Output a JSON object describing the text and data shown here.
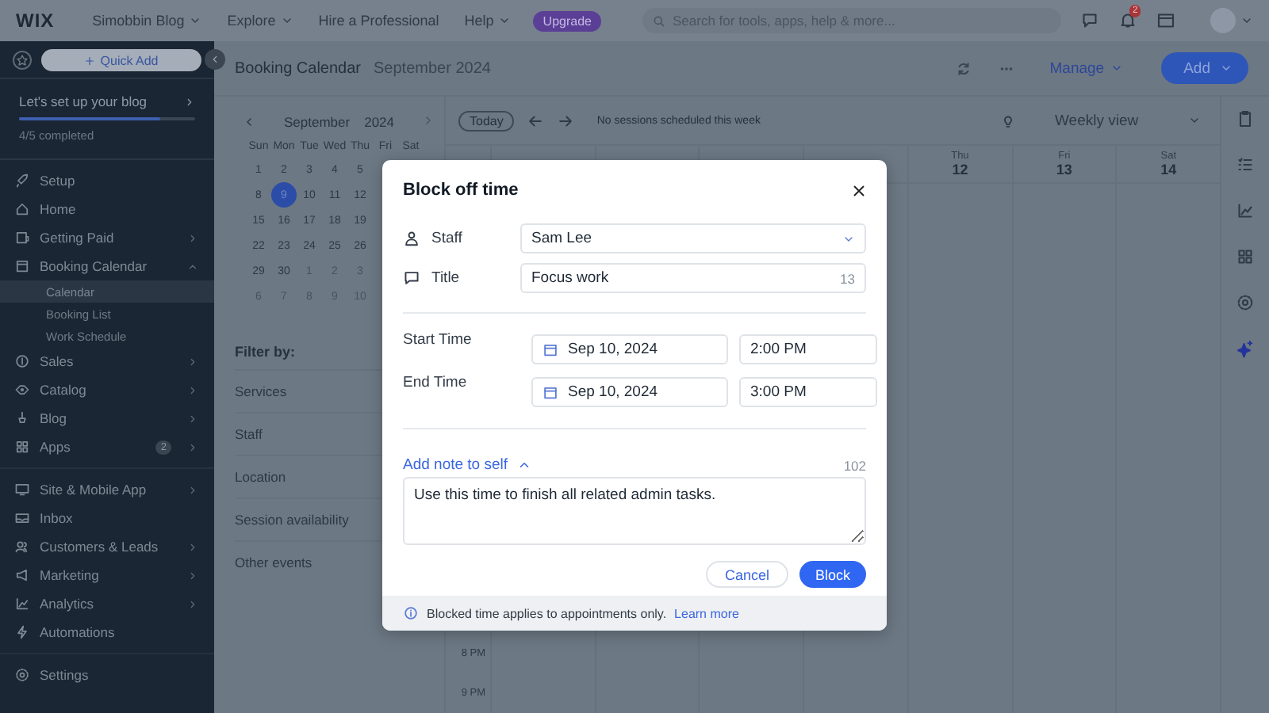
{
  "topbar": {
    "logo": "WIX",
    "site": "Simobbin Blog",
    "nav": [
      {
        "label": "Explore",
        "has_menu": true
      },
      {
        "label": "Hire a Professional",
        "has_menu": false
      },
      {
        "label": "Help",
        "has_menu": true
      }
    ],
    "upgrade": "Upgrade",
    "search": {
      "placeholder": "Search for tools, apps, help & more..."
    },
    "notification_count": "2"
  },
  "sidebar": {
    "quick_add": "Quick Add",
    "setup": {
      "title": "Let's set up your blog",
      "level": 0.8,
      "progress": "4/5 completed"
    },
    "sections": [
      [
        {
          "label": "Setup",
          "expandable": false
        },
        {
          "label": "Home",
          "expandable": false
        },
        {
          "label": "Getting Paid",
          "expandable": true,
          "expanded": false
        },
        {
          "label": "Booking Calendar",
          "expandable": true,
          "expanded": true,
          "children": [
            {
              "label": "Calendar",
              "selected": true
            },
            {
              "label": "Booking List",
              "selected": false
            },
            {
              "label": "Work Schedule",
              "selected": false
            }
          ]
        },
        {
          "label": "Sales",
          "expandable": true,
          "expanded": false
        },
        {
          "label": "Catalog",
          "expandable": true,
          "expanded": false
        },
        {
          "label": "Blog",
          "expandable": true,
          "expanded": false
        },
        {
          "label": "Apps",
          "expandable": true,
          "expanded": false,
          "badge": "2"
        }
      ],
      [
        {
          "label": "Site & Mobile App",
          "expandable": true,
          "expanded": false
        },
        {
          "label": "Inbox",
          "expandable": false
        },
        {
          "label": "Customers & Leads",
          "expandable": true,
          "expanded": false
        },
        {
          "label": "Marketing",
          "expandable": true,
          "expanded": false
        },
        {
          "label": "Analytics",
          "expandable": true,
          "expanded": false
        },
        {
          "label": "Automations",
          "expandable": false
        }
      ],
      [
        {
          "label": "Settings",
          "expandable": false
        }
      ]
    ]
  },
  "header": {
    "title": "Booking Calendar",
    "subtitle": "September 2024",
    "manage": "Manage",
    "add": "Add"
  },
  "mini_calendar": {
    "month": "September",
    "year": "2024",
    "weekdays": [
      "Sun",
      "Mon",
      "Tue",
      "Wed",
      "Thu",
      "Fri",
      "Sat"
    ],
    "weeks": [
      [
        {
          "label": "1",
          "outside": false,
          "selected": false
        },
        {
          "label": "2",
          "outside": false,
          "selected": false
        },
        {
          "label": "3",
          "outside": false,
          "selected": false
        },
        {
          "label": "4",
          "outside": false,
          "selected": false
        },
        {
          "label": "5",
          "outside": false,
          "selected": false
        }
      ],
      [
        {
          "label": "8",
          "outside": false,
          "selected": false
        },
        {
          "label": "9",
          "outside": false,
          "selected": true
        },
        {
          "label": "10",
          "outside": false,
          "selected": false
        },
        {
          "label": "11",
          "outside": false,
          "selected": false
        },
        {
          "label": "12",
          "outside": false,
          "selected": false
        }
      ],
      [
        {
          "label": "15",
          "outside": false,
          "selected": false
        },
        {
          "label": "16",
          "outside": false,
          "selected": false
        },
        {
          "label": "17",
          "outside": false,
          "selected": false
        },
        {
          "label": "18",
          "outside": false,
          "selected": false
        },
        {
          "label": "19",
          "outside": false,
          "selected": false
        }
      ],
      [
        {
          "label": "22",
          "outside": false,
          "selected": false
        },
        {
          "label": "23",
          "outside": false,
          "selected": false
        },
        {
          "label": "24",
          "outside": false,
          "selected": false
        },
        {
          "label": "25",
          "outside": false,
          "selected": false
        },
        {
          "label": "26",
          "outside": false,
          "selected": false
        }
      ],
      [
        {
          "label": "29",
          "outside": false,
          "selected": false
        },
        {
          "label": "30",
          "outside": false,
          "selected": false
        },
        {
          "label": "1",
          "outside": true,
          "selected": false
        },
        {
          "label": "2",
          "outside": true,
          "selected": false
        },
        {
          "label": "3",
          "outside": true,
          "selected": false
        }
      ],
      [
        {
          "label": "6",
          "outside": true,
          "selected": false
        },
        {
          "label": "7",
          "outside": true,
          "selected": false
        },
        {
          "label": "8",
          "outside": true,
          "selected": false
        },
        {
          "label": "9",
          "outside": true,
          "selected": false
        },
        {
          "label": "10",
          "outside": true,
          "selected": false
        }
      ]
    ]
  },
  "filters": {
    "title": "Filter by:",
    "items": [
      "Services",
      "Staff",
      "Location",
      "Session availability",
      "Other events"
    ]
  },
  "week": {
    "today": "Today",
    "message": "No sessions scheduled this week",
    "view": "Weekly view",
    "days": [
      {
        "weekday": "Thu",
        "date": "12"
      },
      {
        "weekday": "Fri",
        "date": "13"
      },
      {
        "weekday": "Sat",
        "date": "14"
      }
    ],
    "times": [
      "8 PM",
      "9 PM"
    ]
  },
  "dialog": {
    "title": "Block off time",
    "staff": {
      "label": "Staff",
      "value": "Sam Lee"
    },
    "title_field": {
      "label": "Title",
      "value": "Focus work",
      "counter": "13"
    },
    "start": {
      "label": "Start Time",
      "date": "Sep 10, 2024",
      "time": "2:00 PM"
    },
    "end": {
      "label": "End Time",
      "date": "Sep 10, 2024",
      "time": "3:00 PM"
    },
    "note": {
      "toggle": "Add note to self",
      "expanded": true,
      "counter": "102",
      "value": "Use this time to finish all related admin tasks."
    },
    "cancel": "Cancel",
    "confirm": "Block",
    "footer": {
      "text": "Blocked time applies to appointments only.",
      "link": "Learn more"
    }
  }
}
